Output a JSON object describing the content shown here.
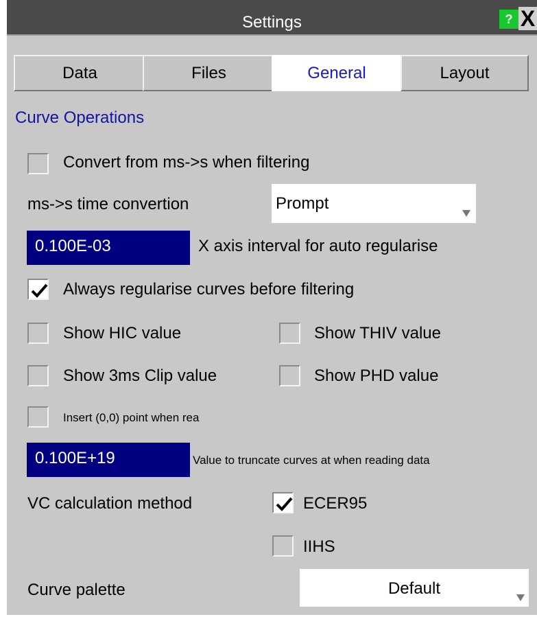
{
  "window": {
    "title": "Settings",
    "help_label": "?",
    "close_label": "X"
  },
  "tabs": [
    {
      "label": "Data",
      "active": false
    },
    {
      "label": "Files",
      "active": false
    },
    {
      "label": "General",
      "active": true
    },
    {
      "label": "Layout",
      "active": false
    }
  ],
  "section": {
    "title": "Curve Operations"
  },
  "options": {
    "convert_ms_label": "Convert from ms->s when filtering",
    "convert_ms_checked": false,
    "time_conversion_label": "ms->s time convertion",
    "time_conversion_value": "Prompt",
    "x_interval_value": "0.100E-03",
    "x_interval_label": "X axis interval for auto regularise",
    "always_regularise_label": "Always regularise curves before filtering",
    "always_regularise_checked": true,
    "show_hic_label": "Show HIC value",
    "show_hic_checked": false,
    "show_thiv_label": "Show THIV value",
    "show_thiv_checked": false,
    "show_3ms_label": "Show 3ms Clip value",
    "show_3ms_checked": false,
    "show_phd_label": "Show PHD value",
    "show_phd_checked": false,
    "insert_point_label": "Insert (0,0) point when rea",
    "insert_point_checked": false,
    "truncate_value": "0.100E+19",
    "truncate_label": "Value to truncate curves at when reading data",
    "vc_method_label": "VC calculation method",
    "ecer95_label": "ECER95",
    "ecer95_checked": true,
    "iihs_label": "IIHS",
    "iihs_checked": false,
    "palette_label": "Curve palette",
    "palette_value": "Default"
  },
  "colors": {
    "title_bar": "#4a4a4a",
    "panel_bg": "#c8c8c8",
    "field_bg": "#000080",
    "accent_text": "#1414a0",
    "help_green": "#19c82d"
  }
}
